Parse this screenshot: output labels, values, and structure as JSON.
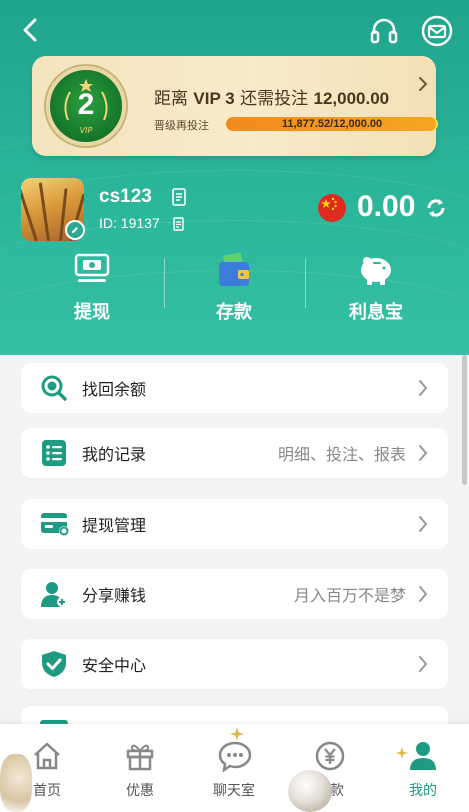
{
  "header": {
    "back_icon": "back-arrow-icon",
    "support_icon": "headset-icon",
    "message_icon": "envelope-icon"
  },
  "vip": {
    "level": "2",
    "badge_text": "VIP",
    "prefix": "距离",
    "next_level": "VIP 3",
    "middle": "还需投注",
    "amount": "12,000.00",
    "sub_label": "晋级再投注",
    "progress_text": "11,877.52/12,000.00",
    "progress_ratio": 0.99
  },
  "user": {
    "name": "cs123",
    "id_text": "ID: 19137",
    "balance": "0.00",
    "flag": "china-flag"
  },
  "actions": [
    {
      "label": "提现",
      "icon": "withdraw-icon"
    },
    {
      "label": "存款",
      "icon": "wallet-icon"
    },
    {
      "label": "利息宝",
      "icon": "piggy-bank-icon"
    }
  ],
  "menu": [
    {
      "label": "找回余额",
      "hint": ""
    },
    {
      "label": "我的记录",
      "hint": "明细、投注、报表"
    },
    {
      "label": "提现管理",
      "hint": ""
    },
    {
      "label": "分享赚钱",
      "hint": "月入百万不是梦"
    },
    {
      "label": "安全中心",
      "hint": ""
    }
  ],
  "tabs": [
    {
      "label": "首页"
    },
    {
      "label": "优惠"
    },
    {
      "label": "聊天室"
    },
    {
      "label": "存款"
    },
    {
      "label": "我的"
    }
  ],
  "colors": {
    "brand": "#23a98f",
    "accent": "#1f9b83",
    "gold": "#f4e4bd"
  }
}
